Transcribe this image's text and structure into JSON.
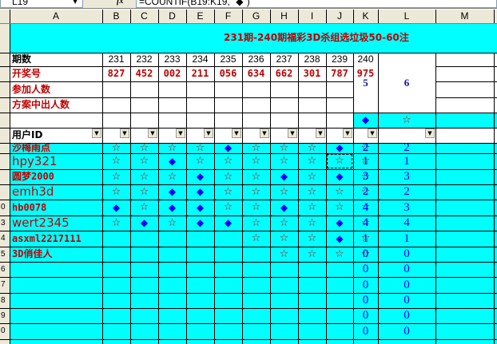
{
  "formula_bar": {
    "name_box": "L19",
    "fx": "fx",
    "formula": "=COUNTIF(B19:K19, \"◆\")"
  },
  "columns": [
    "A",
    "B",
    "C",
    "D",
    "E",
    "F",
    "G",
    "H",
    "I",
    "J",
    "K",
    "L",
    "M"
  ],
  "row_numbers": [
    "",
    "",
    "",
    "",
    "",
    "",
    "",
    "",
    "",
    "",
    "",
    "",
    "",
    "",
    "",
    "",
    "",
    "",
    "",
    "",
    "",
    "",
    ""
  ],
  "title": "231期-240期福彩3D杀组选垃圾50-60注",
  "labels": {
    "issue": "期数",
    "draw": "开奖号",
    "participants": "参加人数",
    "winners": "方案中出人数",
    "userid": "用户ID"
  },
  "issues": [
    "231",
    "232",
    "233",
    "234",
    "235",
    "236",
    "237",
    "238",
    "239",
    "240"
  ],
  "draws": [
    "827",
    "452",
    "002",
    "211",
    "056",
    "634",
    "662",
    "301",
    "787",
    "975"
  ],
  "header_values": {
    "L": "5",
    "M": "6"
  },
  "filter_symbols": {
    "L": "◆",
    "M": "☆"
  },
  "users": [
    {
      "name": "沙梅雨点",
      "marks": [
        "☆",
        "☆",
        "☆",
        "☆",
        "◆",
        "☆",
        "☆",
        "☆",
        "◆",
        "☆"
      ],
      "L": "2",
      "M": "2"
    },
    {
      "name": "hpy321",
      "marks": [
        "☆",
        "☆",
        "◆",
        "☆",
        "☆",
        "☆",
        "☆",
        "☆",
        "☆",
        "☆"
      ],
      "L": "1",
      "M": "1"
    },
    {
      "name": "圆梦2000",
      "marks": [
        "☆",
        "☆",
        "☆",
        "◆",
        "☆",
        "☆",
        "◆",
        "☆",
        "◆",
        "☆"
      ],
      "L": "3",
      "M": "3"
    },
    {
      "name": "emh3d",
      "marks": [
        "☆",
        "☆",
        "◆",
        "◆",
        "☆",
        "☆",
        "☆",
        "☆",
        "☆",
        "☆"
      ],
      "L": "2",
      "M": "2"
    },
    {
      "name": "hb0078",
      "marks": [
        "◆",
        "☆",
        "◆",
        "◆",
        "☆",
        "☆",
        "◆",
        "☆",
        "☆",
        "☆"
      ],
      "L": "4",
      "M": "3"
    },
    {
      "name": "wert2345",
      "marks": [
        "☆",
        "◆",
        "☆",
        "◆",
        "◆",
        "☆",
        "☆",
        "☆",
        "◆",
        "☆"
      ],
      "L": "4",
      "M": "4"
    },
    {
      "name": "asxml2217111",
      "marks": [
        "",
        "",
        "",
        "",
        "",
        "☆",
        "☆",
        "☆",
        "◆",
        "☆"
      ],
      "L": "1",
      "M": "1"
    },
    {
      "name": "3D俏佳人",
      "marks": [
        "",
        "",
        "",
        "",
        "",
        "",
        "☆",
        "☆",
        "☆",
        "☆"
      ],
      "L": "0",
      "M": "0"
    }
  ],
  "empty_rows": [
    {
      "L": "0",
      "M": "0"
    },
    {
      "L": "0",
      "M": "0"
    },
    {
      "L": "0",
      "M": "0"
    },
    {
      "L": "0",
      "M": "0"
    },
    {
      "L": "0",
      "M": "0"
    }
  ],
  "row_num_labels": [
    "",
    "",
    "",
    "",
    "",
    "",
    "",
    "",
    "",
    "",
    "0",
    "3",
    "4",
    "5",
    "6",
    "7",
    "8",
    "9",
    "0"
  ],
  "colors": {
    "cyan": "#00ffff",
    "red": "#c00000",
    "blue": "#0000ff",
    "header_bg": "#ece9d8"
  }
}
